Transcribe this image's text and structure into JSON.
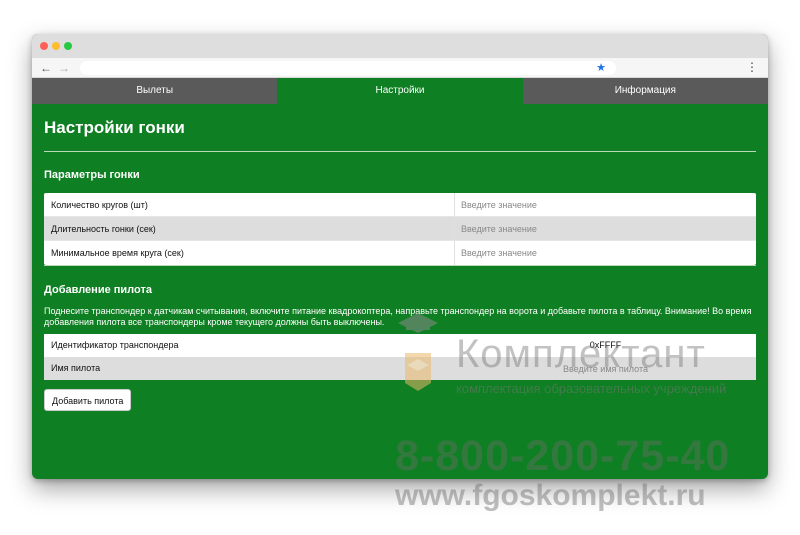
{
  "tabs": [
    {
      "label": "Вылеты"
    },
    {
      "label": "Настройки"
    },
    {
      "label": "Информация"
    }
  ],
  "page_title": "Настройки гонки",
  "race_params": {
    "title": "Параметры гонки",
    "rows": [
      {
        "label": "Количество кругов (шт)",
        "placeholder": "Введите значение"
      },
      {
        "label": "Длительность гонки (сек)",
        "placeholder": "Введите значение"
      },
      {
        "label": "Минимальное время круга (сек)",
        "placeholder": "Введите значение"
      }
    ]
  },
  "add_pilot": {
    "title": "Добавление пилота",
    "instructions": "Поднесите транспондер к датчикам считывания, включите питание квадрокоптера, направьте транспондер на ворота и добавьте пилота в таблицу. Внимание! Во время добавления пилота все транспондеры кроме текущего должны быть выключены.",
    "transponder_label": "Идентификатор транспондера",
    "transponder_value": "0xFFFF",
    "pilot_name_label": "Имя пилота",
    "pilot_name_placeholder": "Введите имя пилота",
    "button_label": "Добавить пилота"
  },
  "watermark": {
    "brand": "Комплектант",
    "subtitle": "комплектация образовательных учреждений",
    "phone": "8-800-200-75-40",
    "url": "www.fgoskomplekt.ru"
  },
  "colors": {
    "background_green": "#0e7f22",
    "tab_inactive": "#5a5a5a"
  }
}
